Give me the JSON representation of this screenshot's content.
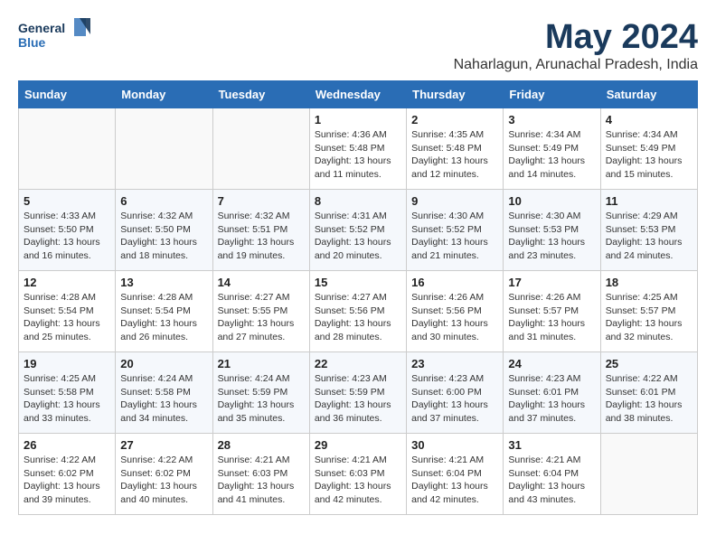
{
  "header": {
    "logo_line1": "General",
    "logo_line2": "Blue",
    "month_year": "May 2024",
    "location": "Naharlagun, Arunachal Pradesh, India"
  },
  "weekdays": [
    "Sunday",
    "Monday",
    "Tuesday",
    "Wednesday",
    "Thursday",
    "Friday",
    "Saturday"
  ],
  "weeks": [
    [
      {
        "day": "",
        "info": ""
      },
      {
        "day": "",
        "info": ""
      },
      {
        "day": "",
        "info": ""
      },
      {
        "day": "1",
        "info": "Sunrise: 4:36 AM\nSunset: 5:48 PM\nDaylight: 13 hours\nand 11 minutes."
      },
      {
        "day": "2",
        "info": "Sunrise: 4:35 AM\nSunset: 5:48 PM\nDaylight: 13 hours\nand 12 minutes."
      },
      {
        "day": "3",
        "info": "Sunrise: 4:34 AM\nSunset: 5:49 PM\nDaylight: 13 hours\nand 14 minutes."
      },
      {
        "day": "4",
        "info": "Sunrise: 4:34 AM\nSunset: 5:49 PM\nDaylight: 13 hours\nand 15 minutes."
      }
    ],
    [
      {
        "day": "5",
        "info": "Sunrise: 4:33 AM\nSunset: 5:50 PM\nDaylight: 13 hours\nand 16 minutes."
      },
      {
        "day": "6",
        "info": "Sunrise: 4:32 AM\nSunset: 5:50 PM\nDaylight: 13 hours\nand 18 minutes."
      },
      {
        "day": "7",
        "info": "Sunrise: 4:32 AM\nSunset: 5:51 PM\nDaylight: 13 hours\nand 19 minutes."
      },
      {
        "day": "8",
        "info": "Sunrise: 4:31 AM\nSunset: 5:52 PM\nDaylight: 13 hours\nand 20 minutes."
      },
      {
        "day": "9",
        "info": "Sunrise: 4:30 AM\nSunset: 5:52 PM\nDaylight: 13 hours\nand 21 minutes."
      },
      {
        "day": "10",
        "info": "Sunrise: 4:30 AM\nSunset: 5:53 PM\nDaylight: 13 hours\nand 23 minutes."
      },
      {
        "day": "11",
        "info": "Sunrise: 4:29 AM\nSunset: 5:53 PM\nDaylight: 13 hours\nand 24 minutes."
      }
    ],
    [
      {
        "day": "12",
        "info": "Sunrise: 4:28 AM\nSunset: 5:54 PM\nDaylight: 13 hours\nand 25 minutes."
      },
      {
        "day": "13",
        "info": "Sunrise: 4:28 AM\nSunset: 5:54 PM\nDaylight: 13 hours\nand 26 minutes."
      },
      {
        "day": "14",
        "info": "Sunrise: 4:27 AM\nSunset: 5:55 PM\nDaylight: 13 hours\nand 27 minutes."
      },
      {
        "day": "15",
        "info": "Sunrise: 4:27 AM\nSunset: 5:56 PM\nDaylight: 13 hours\nand 28 minutes."
      },
      {
        "day": "16",
        "info": "Sunrise: 4:26 AM\nSunset: 5:56 PM\nDaylight: 13 hours\nand 30 minutes."
      },
      {
        "day": "17",
        "info": "Sunrise: 4:26 AM\nSunset: 5:57 PM\nDaylight: 13 hours\nand 31 minutes."
      },
      {
        "day": "18",
        "info": "Sunrise: 4:25 AM\nSunset: 5:57 PM\nDaylight: 13 hours\nand 32 minutes."
      }
    ],
    [
      {
        "day": "19",
        "info": "Sunrise: 4:25 AM\nSunset: 5:58 PM\nDaylight: 13 hours\nand 33 minutes."
      },
      {
        "day": "20",
        "info": "Sunrise: 4:24 AM\nSunset: 5:58 PM\nDaylight: 13 hours\nand 34 minutes."
      },
      {
        "day": "21",
        "info": "Sunrise: 4:24 AM\nSunset: 5:59 PM\nDaylight: 13 hours\nand 35 minutes."
      },
      {
        "day": "22",
        "info": "Sunrise: 4:23 AM\nSunset: 5:59 PM\nDaylight: 13 hours\nand 36 minutes."
      },
      {
        "day": "23",
        "info": "Sunrise: 4:23 AM\nSunset: 6:00 PM\nDaylight: 13 hours\nand 37 minutes."
      },
      {
        "day": "24",
        "info": "Sunrise: 4:23 AM\nSunset: 6:01 PM\nDaylight: 13 hours\nand 37 minutes."
      },
      {
        "day": "25",
        "info": "Sunrise: 4:22 AM\nSunset: 6:01 PM\nDaylight: 13 hours\nand 38 minutes."
      }
    ],
    [
      {
        "day": "26",
        "info": "Sunrise: 4:22 AM\nSunset: 6:02 PM\nDaylight: 13 hours\nand 39 minutes."
      },
      {
        "day": "27",
        "info": "Sunrise: 4:22 AM\nSunset: 6:02 PM\nDaylight: 13 hours\nand 40 minutes."
      },
      {
        "day": "28",
        "info": "Sunrise: 4:21 AM\nSunset: 6:03 PM\nDaylight: 13 hours\nand 41 minutes."
      },
      {
        "day": "29",
        "info": "Sunrise: 4:21 AM\nSunset: 6:03 PM\nDaylight: 13 hours\nand 42 minutes."
      },
      {
        "day": "30",
        "info": "Sunrise: 4:21 AM\nSunset: 6:04 PM\nDaylight: 13 hours\nand 42 minutes."
      },
      {
        "day": "31",
        "info": "Sunrise: 4:21 AM\nSunset: 6:04 PM\nDaylight: 13 hours\nand 43 minutes."
      },
      {
        "day": "",
        "info": ""
      }
    ]
  ]
}
